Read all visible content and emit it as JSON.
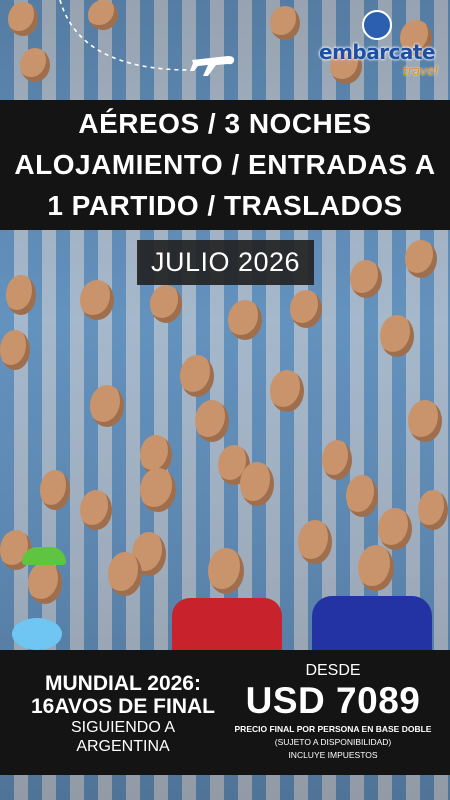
{
  "brand": {
    "name": "embarcate",
    "tagline": "travel",
    "colors": {
      "primary": "#1c4fa5",
      "accent": "#e58a1f"
    }
  },
  "headline": {
    "line1": "AÉREOS / 3 NOCHES",
    "line2": "ALOJAMIENTO / ENTRADAS A",
    "line3": "1 PARTIDO / TRASLADOS"
  },
  "date": "JULIO 2026",
  "event": {
    "line1": "MUNDIAL 2026:",
    "line2": "16AVOS DE FINAL",
    "line3": "SIGUIENDO A",
    "line4": "ARGENTINA"
  },
  "pricing": {
    "from_label": "DESDE",
    "price": "USD 7089",
    "note1": "PRECIO FINAL POR PERSONA EN BASE DOBLE",
    "note2": "(SUJETO A DISPONIBILIDAD)",
    "note3": "INCLUYE IMPUESTOS"
  },
  "icons": [
    "airplane-icon",
    "logo-icon"
  ],
  "colors": {
    "band": "#141414",
    "text": "#ffffff"
  }
}
